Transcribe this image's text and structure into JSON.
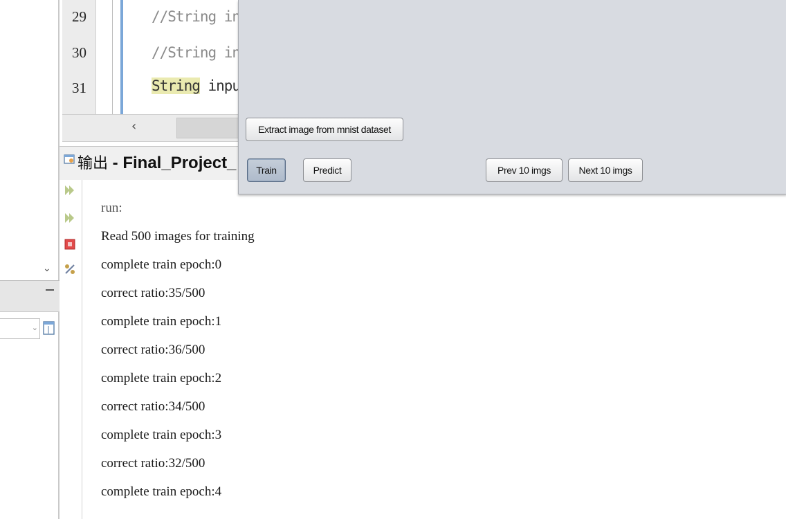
{
  "editor": {
    "lines": [
      {
        "number": "29",
        "code": "//String in",
        "kind": "comment"
      },
      {
        "number": "30",
        "code": "//String in",
        "kind": "comment"
      },
      {
        "number": "31",
        "keyword": "String",
        "rest": " inpu",
        "kind": "code"
      }
    ]
  },
  "output": {
    "title_zh": "输出",
    "title_sep": " - ",
    "title_project": "Final_Project_",
    "lines": [
      "run:",
      "Read 500 images for training",
      "complete train epoch:0",
      "correct ratio:35/500",
      "complete train epoch:1",
      "correct ratio:36/500",
      "complete train epoch:2",
      "correct ratio:34/500",
      "complete train epoch:3",
      "correct ratio:32/500",
      "complete train epoch:4"
    ]
  },
  "dialog": {
    "extract_label": "Extract image from mnist dataset",
    "train_label": "Train",
    "predict_label": "Predict",
    "prev_label": "Prev 10 imgs",
    "next_label": "Next 10 imgs"
  },
  "icons": {
    "scroll_left": "‹",
    "collapse": "v"
  }
}
